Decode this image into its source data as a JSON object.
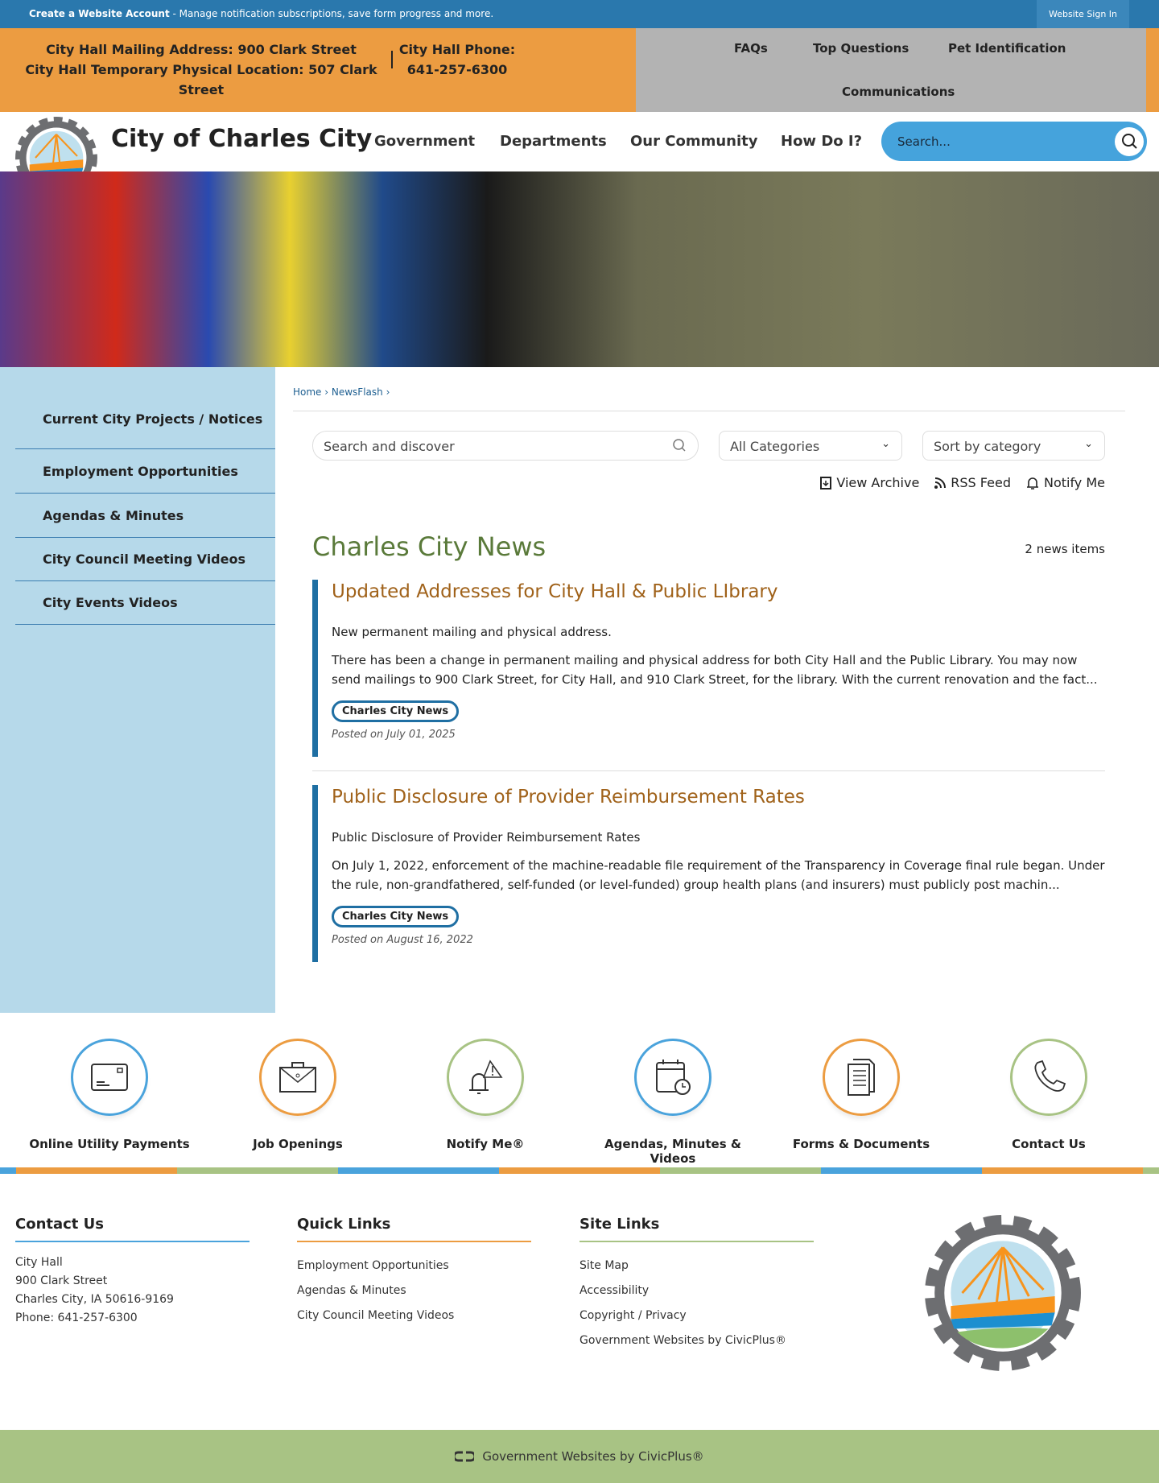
{
  "topbar": {
    "create_account": "Create a Website Account",
    "create_desc": " - Manage notification subscriptions, save form progress and more.",
    "sign_in": "Website Sign In"
  },
  "info": {
    "mailing": "City Hall Mailing Address: 900 Clark Street",
    "physical": "City Hall Temporary Physical Location: 507 Clark Street",
    "phone_label": "City Hall Phone:",
    "phone": "641-257-6300"
  },
  "quicklinks_top": [
    "FAQs",
    "Top Questions",
    "Pet Identification",
    "Communications"
  ],
  "header": {
    "title": "City of Charles City",
    "nav": [
      "Government",
      "Departments",
      "Our Community",
      "How Do I?"
    ],
    "search_placeholder": "Search..."
  },
  "sidebar": {
    "items": [
      "Current City Projects / Notices",
      "Employment Opportunities",
      "Agendas & Minutes",
      "City Council Meeting Videos",
      "City Events Videos"
    ]
  },
  "breadcrumb": [
    "Home",
    "NewsFlash"
  ],
  "filters": {
    "search_placeholder": "Search and discover",
    "category": "All Categories",
    "sort": "Sort by category"
  },
  "actions": {
    "archive": "View Archive",
    "rss": "RSS Feed",
    "notify": "Notify Me"
  },
  "news": {
    "title": "Charles City News",
    "count": "2 news items",
    "items": [
      {
        "title": "Updated Addresses for City Hall & Public LIbrary",
        "summary": "New permanent mailing and physical address.",
        "desc": "There has been a change in permanent mailing and physical address for both City Hall and the Public Library. You may now send mailings to 900 Clark Street, for City Hall, and 910 Clark Street, for the library. With the current renovation and the fact...",
        "tag": "Charles City News",
        "date": "Posted on July 01, 2025"
      },
      {
        "title": "Public Disclosure of Provider Reimbursement Rates",
        "summary": "Public Disclosure of Provider Reimbursement Rates",
        "desc": "On July 1, 2022, enforcement of the machine-readable file requirement of the Transparency in Coverage final rule began.  Under the rule, non-grandfathered, self-funded (or level-funded) group health plans (and insurers) must publicly post machin...",
        "tag": "Charles City News",
        "date": "Posted on August 16, 2022"
      }
    ]
  },
  "quick": [
    {
      "label": "Online Utility Payments",
      "color": "#4aa3dc"
    },
    {
      "label": "Job Openings",
      "color": "#ec9c41"
    },
    {
      "label": "Notify Me®",
      "color": "#a8c384"
    },
    {
      "label": "Agendas, Minutes & Videos",
      "color": "#4aa3dc"
    },
    {
      "label": "Forms & Documents",
      "color": "#ec9c41"
    },
    {
      "label": "Contact Us",
      "color": "#a8c384"
    }
  ],
  "footer": {
    "contact": {
      "heading": "Contact Us",
      "lines": [
        "City Hall",
        "900 Clark Street",
        "Charles City, IA 50616-9169",
        "Phone: 641-257-6300"
      ]
    },
    "quick": {
      "heading": "Quick Links",
      "links": [
        "Employment Opportunities",
        "Agendas & Minutes",
        "City Council Meeting Videos"
      ]
    },
    "site": {
      "heading": "Site Links",
      "links": [
        "Site Map",
        "Accessibility",
        "Copyright / Privacy",
        "Government Websites by CivicPlus®"
      ]
    },
    "bottom": "Government Websites by CivicPlus®"
  },
  "colors": {
    "blue": "#2a78ad",
    "orange": "#ec9c41",
    "green": "#a8c384",
    "sky": "#4aa3dc"
  }
}
